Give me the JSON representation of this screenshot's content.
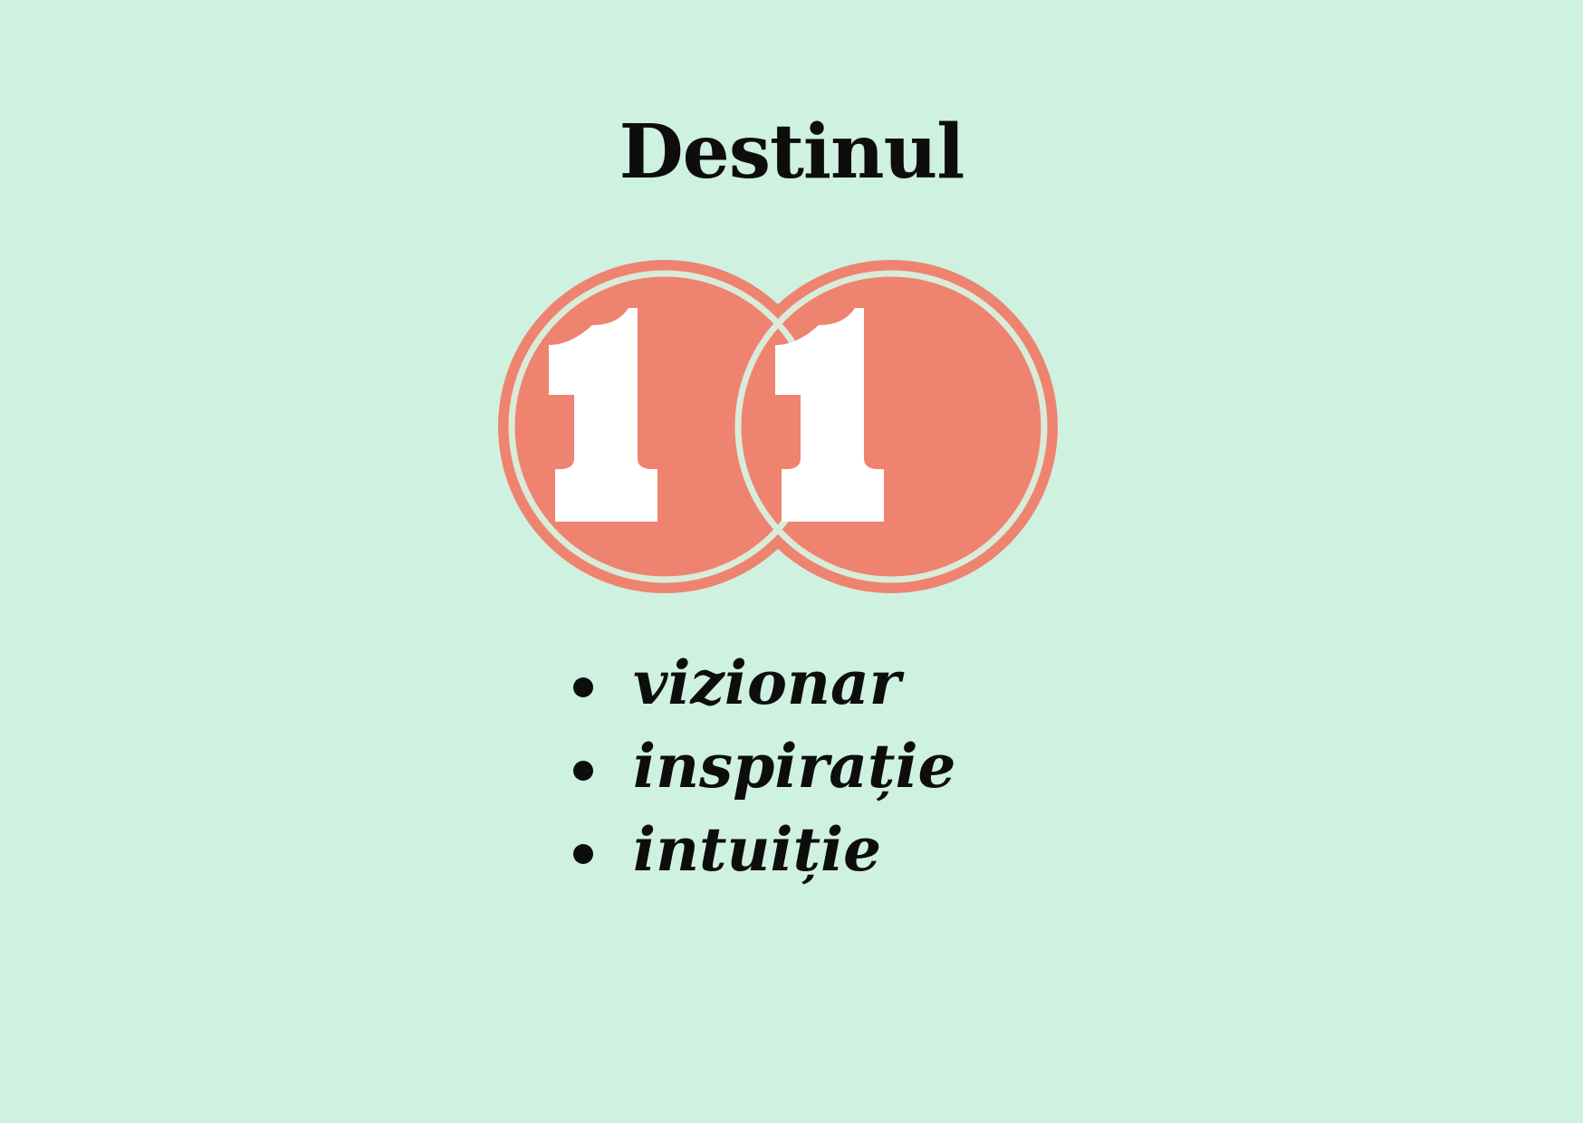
{
  "title": "Destinul",
  "number": {
    "digit_left": "1",
    "digit_right": "1"
  },
  "traits": [
    "vizionar",
    "inspirație",
    "intuiție"
  ],
  "colors": {
    "background": "#cff1e0",
    "circle": "#ee8370",
    "ring": "#d8ecd9",
    "digit": "#ffffff",
    "text": "#0d0d0d"
  }
}
